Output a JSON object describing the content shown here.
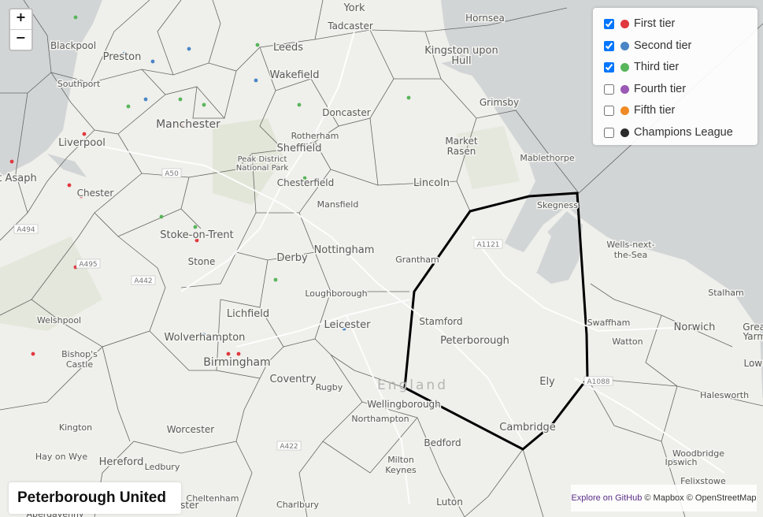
{
  "zoom": {
    "in_label": "+",
    "out_label": "−"
  },
  "legend": [
    {
      "label": "First tier",
      "checked": true,
      "color": "#e0383e"
    },
    {
      "label": "Second tier",
      "checked": true,
      "color": "#4a86c5"
    },
    {
      "label": "Third tier",
      "checked": true,
      "color": "#57b55a"
    },
    {
      "label": "Fourth tier",
      "checked": false,
      "color": "#9a59b5"
    },
    {
      "label": "Fifth tier",
      "checked": false,
      "color": "#f08a24"
    },
    {
      "label": "Champions League",
      "checked": false,
      "color": "#2b2b2b"
    }
  ],
  "club_name": "Peterborough United",
  "attribution": {
    "link": "Explore on GitHub",
    "rest": " © Mapbox © OpenStreetMap"
  },
  "country_label": "England",
  "places": [
    {
      "t": "York"
    },
    {
      "t": "Tadcaster"
    },
    {
      "t": "Hornsea"
    },
    {
      "t": "Blackpool"
    },
    {
      "t": "Preston"
    },
    {
      "t": "Leeds"
    },
    {
      "t": "Kingston upon"
    },
    {
      "t": "Hull"
    },
    {
      "t": "Wakefield"
    },
    {
      "t": "Southport"
    },
    {
      "t": "Grimsby"
    },
    {
      "t": "Doncaster"
    },
    {
      "t": "Manchester"
    },
    {
      "t": "Rotherham"
    },
    {
      "t": "Liverpool"
    },
    {
      "t": "Market"
    },
    {
      "t": "Rasen"
    },
    {
      "t": "Sheffield"
    },
    {
      "t": "Mablethorpe"
    },
    {
      "t": "Peak District"
    },
    {
      "t": "National Park"
    },
    {
      "t": "t Asaph"
    },
    {
      "t": "Chesterfield"
    },
    {
      "t": "Lincoln"
    },
    {
      "t": "Chester"
    },
    {
      "t": "Skegness"
    },
    {
      "t": "Mansfield"
    },
    {
      "t": "Stoke-on-Trent"
    },
    {
      "t": "Grantham"
    },
    {
      "t": "Nottingham"
    },
    {
      "t": "Derby"
    },
    {
      "t": "Wells-next-"
    },
    {
      "t": "the-Sea"
    },
    {
      "t": "Stone"
    },
    {
      "t": "Stalham"
    },
    {
      "t": "Loughborough"
    },
    {
      "t": "Welshpool"
    },
    {
      "t": "Lichfield"
    },
    {
      "t": "Swaffham"
    },
    {
      "t": "Stamford"
    },
    {
      "t": "Leicester"
    },
    {
      "t": "Norwich"
    },
    {
      "t": "Great"
    },
    {
      "t": "Yarmo"
    },
    {
      "t": "Wolverhampton"
    },
    {
      "t": "Peterborough"
    },
    {
      "t": "Watton"
    },
    {
      "t": "Bishop's"
    },
    {
      "t": "Castle"
    },
    {
      "t": "Birmingham"
    },
    {
      "t": "Lowe"
    },
    {
      "t": "Coventry"
    },
    {
      "t": "Rugby"
    },
    {
      "t": "Ely"
    },
    {
      "t": "Halesworth"
    },
    {
      "t": "Wellingborough"
    },
    {
      "t": "Kington"
    },
    {
      "t": "Worcester"
    },
    {
      "t": "Northampton"
    },
    {
      "t": "Cambridge"
    },
    {
      "t": "Hay on Wye"
    },
    {
      "t": "Hereford"
    },
    {
      "t": "Bedford"
    },
    {
      "t": "Woodbridge"
    },
    {
      "t": "Ledbury"
    },
    {
      "t": "Ipswich"
    },
    {
      "t": "Milton"
    },
    {
      "t": "Keynes"
    },
    {
      "t": "Felixstowe"
    },
    {
      "t": "Cheltenham"
    },
    {
      "t": "Gloucester"
    },
    {
      "t": "Charlbury"
    },
    {
      "t": "Luton"
    },
    {
      "t": "Abergavenny"
    }
  ],
  "roads": [
    "A50",
    "A494",
    "A495",
    "A442",
    "A1121",
    "A422",
    "A1088"
  ],
  "clubs": [
    {
      "tier": 1
    },
    {
      "tier": 1
    },
    {
      "tier": 1
    },
    {
      "tier": 1
    },
    {
      "tier": 1
    },
    {
      "tier": 1
    },
    {
      "tier": 1
    },
    {
      "tier": 1
    },
    {
      "tier": 1
    },
    {
      "tier": 1
    },
    {
      "tier": 1
    },
    {
      "tier": 2
    },
    {
      "tier": 2
    },
    {
      "tier": 2
    },
    {
      "tier": 2
    },
    {
      "tier": 2
    },
    {
      "tier": 2
    },
    {
      "tier": 2
    },
    {
      "tier": 2
    },
    {
      "tier": 2
    },
    {
      "tier": 2
    },
    {
      "tier": 2
    },
    {
      "tier": 2
    },
    {
      "tier": 2
    },
    {
      "tier": 3
    },
    {
      "tier": 3
    },
    {
      "tier": 3
    },
    {
      "tier": 3
    },
    {
      "tier": 3
    },
    {
      "tier": 3
    },
    {
      "tier": 3
    },
    {
      "tier": 3
    },
    {
      "tier": 3
    },
    {
      "tier": 3
    },
    {
      "tier": 3
    },
    {
      "tier": 3
    },
    {
      "tier": 3
    }
  ]
}
